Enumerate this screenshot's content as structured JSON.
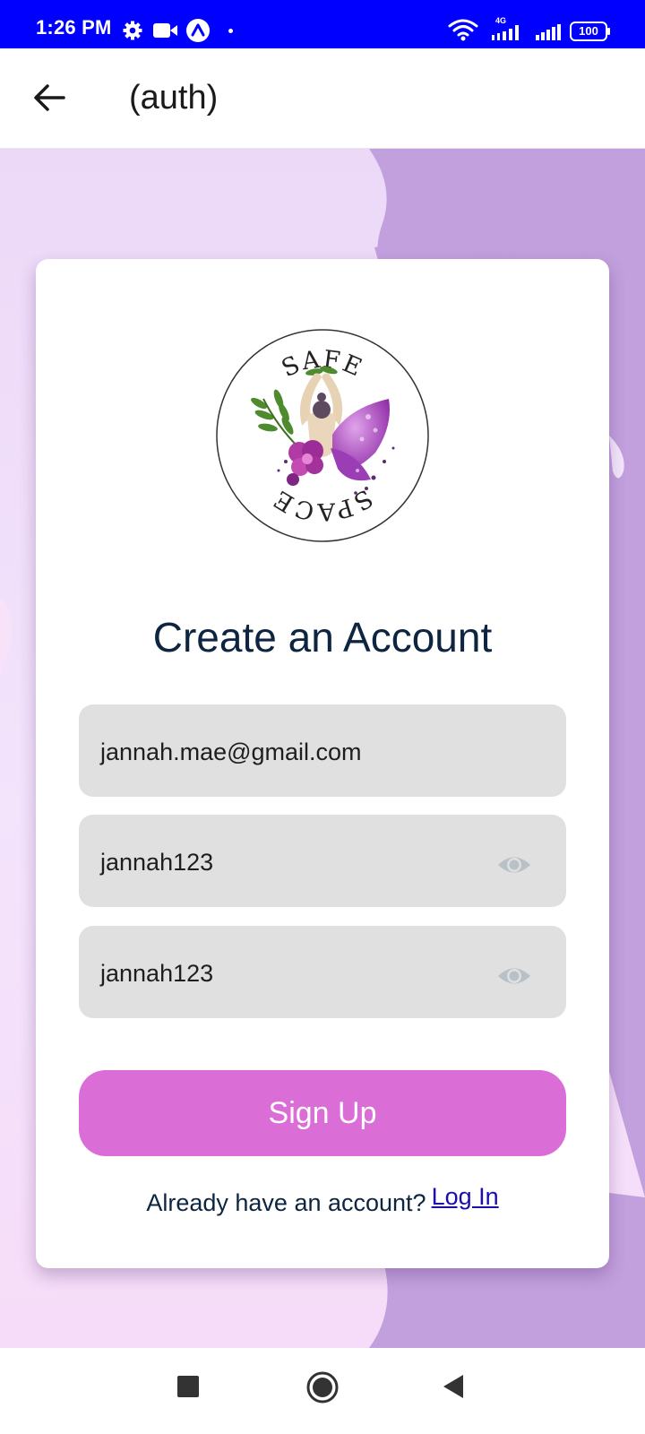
{
  "status_bar": {
    "time": "1:26 PM",
    "battery": "100",
    "network_label": "4G",
    "icons": [
      "gear-icon",
      "video-camera-icon",
      "expo-icon",
      "wifi-icon",
      "signal-4g-icon",
      "signal-icon",
      "battery-icon"
    ]
  },
  "app_bar": {
    "title": "(auth)",
    "back_icon": "arrow-left-icon"
  },
  "logo": {
    "top_text": "SAFE",
    "bottom_text": "SPACE"
  },
  "form": {
    "heading": "Create an Account",
    "email_value": "jannah.mae@gmail.com",
    "password_value": "jannah123",
    "confirm_password_value": "jannah123",
    "eye_icon": "eye-icon",
    "submit_label": "Sign Up"
  },
  "footer": {
    "prompt": "Already have an account?",
    "login_label": "Log In"
  },
  "nav_bar": {
    "icons": [
      "square-recents-icon",
      "circle-home-icon",
      "triangle-back-icon"
    ]
  },
  "colors": {
    "status_bar": "#0000ff",
    "background_light": "#f1e3fb",
    "background_purple": "#c29fdd",
    "button": "#da6ed6",
    "heading_text": "#0d2540",
    "field_bg": "#e0e0e0",
    "link": "#1a0dab"
  }
}
